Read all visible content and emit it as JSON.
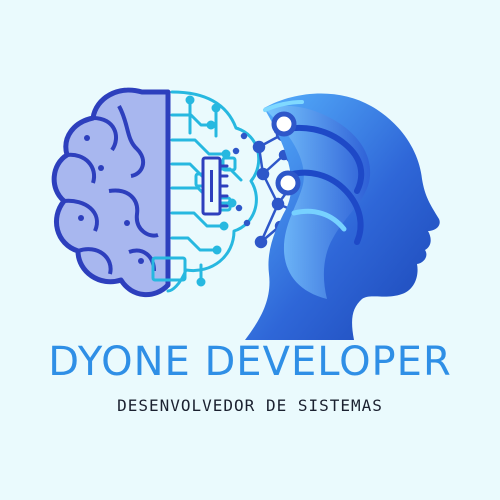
{
  "brand": {
    "title": "DYONE DEVELOPER",
    "subtitle": "DESENVOLVEDOR DE SISTEMAS"
  },
  "colors": {
    "background": "#eafafd",
    "title": "#2f8fe6",
    "subtitle": "#1b2130",
    "brain_fill": "#a8b7ef",
    "brain_stroke": "#2d3fbd",
    "circuit": "#27b8e0",
    "head_primary": "#2f67d8",
    "head_light": "#59b6ff",
    "network": "#2e57c9"
  },
  "icons": {
    "logo": "brain-circuit-head-logo"
  }
}
